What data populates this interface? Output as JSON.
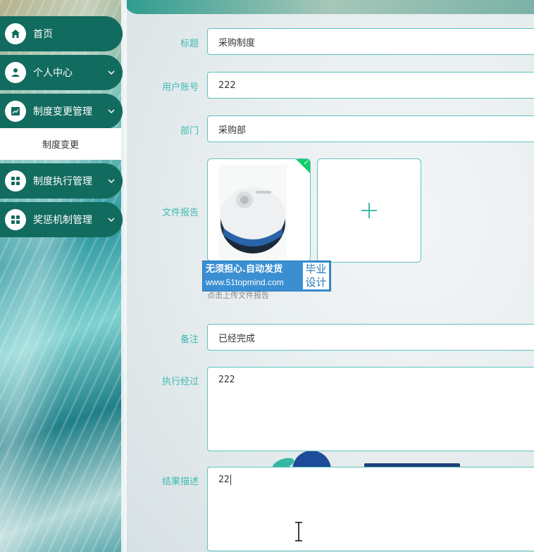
{
  "sidebar": {
    "items": [
      {
        "label": "首页",
        "icon": "home-icon",
        "expandable": false
      },
      {
        "label": "个人中心",
        "icon": "user-icon",
        "expandable": true
      },
      {
        "label": "制度变更管理",
        "icon": "chart-icon",
        "expandable": true
      },
      {
        "label": "制度执行管理",
        "icon": "grid-icon",
        "expandable": true
      },
      {
        "label": "奖惩机制管理",
        "icon": "grid-icon",
        "expandable": true
      }
    ],
    "submenu": {
      "label": "制度变更"
    }
  },
  "form": {
    "title": {
      "label": "标题",
      "value": "采购制度"
    },
    "account": {
      "label": "用户账号",
      "value": "222"
    },
    "department": {
      "label": "部门",
      "value": "采购部"
    },
    "file_report": {
      "label": "文件报告",
      "upload_tip": "点击上传文件报告"
    },
    "remark": {
      "label": "备注",
      "value": "已经完成"
    },
    "execution": {
      "label": "执行经过",
      "value": "222"
    },
    "result": {
      "label": "结果描述",
      "value": "22"
    }
  },
  "watermark": {
    "line1": "无须担心.自动发货",
    "line2": "www.51topmind.com",
    "right_top": "毕业",
    "right_bottom": "设计"
  },
  "colors": {
    "sidebar": "#126b5f",
    "accent": "#3fbab0",
    "border": "#5fc4bc",
    "success": "#13ce66"
  }
}
